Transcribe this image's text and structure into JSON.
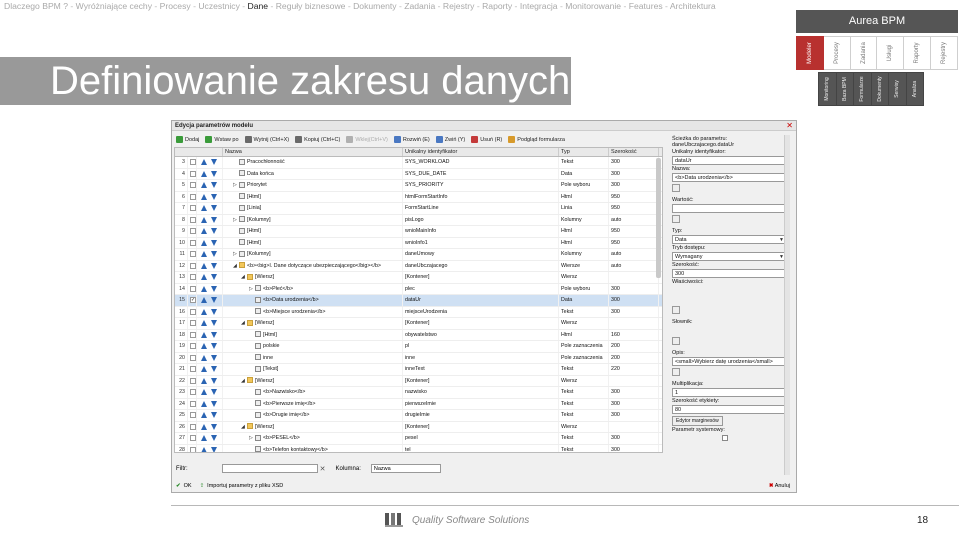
{
  "nav": {
    "items": [
      "Dlaczego BPM ?",
      "Wyróżniające cechy",
      "Procesy",
      "Uczestnicy",
      "Dane",
      "Reguły biznesowe",
      "Dokumenty",
      "Zadania",
      "Rejestry",
      "Raporty",
      "Integracja",
      "Monitorowanie",
      "Features",
      "Architektura"
    ],
    "active": "Dane"
  },
  "brand": "Aurea BPM",
  "vtabs": [
    "Modeler",
    "Procesy",
    "Zadania",
    "Usługi",
    "Raporty",
    "Rejestry"
  ],
  "subtabs": [
    "Monitoring",
    "Baza BPM",
    "Formularze",
    "Dokumenty",
    "Serwisy",
    "Analiza"
  ],
  "slide_title": "Definiowanie zakresu danych",
  "window": {
    "title": "Edycja parametrów modelu",
    "toolbar": [
      {
        "label": "Dodaj",
        "color": "#3a9b3a"
      },
      {
        "label": "Wstaw po",
        "color": "#3a9b3a"
      },
      {
        "label": "Wytnij (Ctrl+X)",
        "color": "#6a6a6a"
      },
      {
        "label": "Kopiuj (Ctrl+C)",
        "color": "#6a6a6a"
      },
      {
        "label": "Wklej(Ctrl+V)",
        "color": "#b0b0b0",
        "disabled": true
      },
      {
        "label": "Rozwiń (E)",
        "color": "#4a78c2"
      },
      {
        "label": "Zwiń (Y)",
        "color": "#4a78c2"
      },
      {
        "label": "Usuń (R)",
        "color": "#c43a3a"
      },
      {
        "label": "Podgląd formularza",
        "color": "#d79a2b"
      }
    ],
    "columns": [
      "Nazwa",
      "Unikalny identyfikator",
      "Typ",
      "Szerokość"
    ],
    "rows": [
      {
        "n": "3",
        "name": "Pracochłonność",
        "id": "SYS_WORKLOAD",
        "type": "Tekst",
        "w": "300",
        "indent": 1,
        "icon": "doc"
      },
      {
        "n": "4",
        "name": "Data końca",
        "id": "SYS_DUE_DATE",
        "type": "Data",
        "w": "300",
        "indent": 1,
        "icon": "doc"
      },
      {
        "n": "5",
        "name": "Priorytet",
        "id": "SYS_PRIORITY",
        "type": "Pole wyboru",
        "w": "300",
        "indent": 1,
        "icon": "doc",
        "exp": "▷"
      },
      {
        "n": "6",
        "name": "[Html]",
        "id": "htmlFormStartInfo",
        "type": "Html",
        "w": "950",
        "indent": 1,
        "icon": "doc"
      },
      {
        "n": "7",
        "name": "[Linia]",
        "id": "FormStartLine",
        "type": "Linia",
        "w": "950",
        "indent": 1,
        "icon": "doc"
      },
      {
        "n": "8",
        "name": "[Kolumny]",
        "id": "pisLogo",
        "type": "Kolumny",
        "w": "auto",
        "indent": 1,
        "icon": "doc",
        "exp": "▷"
      },
      {
        "n": "9",
        "name": "[Html]",
        "id": "wnioMainInfo",
        "type": "Html",
        "w": "950",
        "indent": 1,
        "icon": "doc"
      },
      {
        "n": "10",
        "name": "[Html]",
        "id": "wnioInfo1",
        "type": "Html",
        "w": "950",
        "indent": 1,
        "icon": "doc"
      },
      {
        "n": "11",
        "name": "[Kolumny]",
        "id": "daneUmowy",
        "type": "Kolumny",
        "w": "auto",
        "indent": 1,
        "icon": "doc",
        "exp": "▷"
      },
      {
        "n": "12",
        "name": "<b><big>I. Dane dotyczące ubezpieczającego</big></b>",
        "id": "daneUbczajacego",
        "type": "Wiersze",
        "w": "auto",
        "indent": 1,
        "icon": "folder",
        "exp": "◢"
      },
      {
        "n": "13",
        "name": "[Wiersz]",
        "id": "[Kontener]",
        "type": "Wiersz",
        "w": "",
        "indent": 2,
        "icon": "folder",
        "exp": "◢"
      },
      {
        "n": "14",
        "name": "<b>Płeć</b>",
        "id": "plec",
        "type": "Pole wyboru",
        "w": "300",
        "indent": 3,
        "icon": "doc",
        "exp": "▷"
      },
      {
        "n": "15",
        "name": "<b>Data urodzenia</b>",
        "id": "dataUr",
        "type": "Data",
        "w": "300",
        "indent": 3,
        "icon": "doc",
        "sel": true
      },
      {
        "n": "16",
        "name": "<b>Miejsce urodzenia</b>",
        "id": "miejsceUrodzenia",
        "type": "Tekst",
        "w": "300",
        "indent": 3,
        "icon": "doc"
      },
      {
        "n": "17",
        "name": "[Wiersz]",
        "id": "[Kontener]",
        "type": "Wiersz",
        "w": "",
        "indent": 2,
        "icon": "folder",
        "exp": "◢"
      },
      {
        "n": "18",
        "name": "[Html]",
        "id": "obywatelstwo",
        "type": "Html",
        "w": "160",
        "indent": 3,
        "icon": "doc"
      },
      {
        "n": "19",
        "name": "polskie",
        "id": "pl",
        "type": "Pole zaznaczenia",
        "w": "200",
        "indent": 3,
        "icon": "doc"
      },
      {
        "n": "20",
        "name": "inne",
        "id": "inne",
        "type": "Pole zaznaczenia",
        "w": "200",
        "indent": 3,
        "icon": "doc"
      },
      {
        "n": "21",
        "name": "[Tekst]",
        "id": "inneText",
        "type": "Tekst",
        "w": "220",
        "indent": 3,
        "icon": "doc"
      },
      {
        "n": "22",
        "name": "[Wiersz]",
        "id": "[Kontener]",
        "type": "Wiersz",
        "w": "",
        "indent": 2,
        "icon": "folder",
        "exp": "◢"
      },
      {
        "n": "23",
        "name": "<b>Nazwisko</b>",
        "id": "nazwisko",
        "type": "Tekst",
        "w": "300",
        "indent": 3,
        "icon": "doc"
      },
      {
        "n": "24",
        "name": "<b>Pierwsze imię</b>",
        "id": "pierwszeImie",
        "type": "Tekst",
        "w": "300",
        "indent": 3,
        "icon": "doc"
      },
      {
        "n": "25",
        "name": "<b>Drugie imię</b>",
        "id": "drugieImie",
        "type": "Tekst",
        "w": "300",
        "indent": 3,
        "icon": "doc"
      },
      {
        "n": "26",
        "name": "[Wiersz]",
        "id": "[Kontener]",
        "type": "Wiersz",
        "w": "",
        "indent": 2,
        "icon": "folder",
        "exp": "◢"
      },
      {
        "n": "27",
        "name": "<b>PESEL</b>",
        "id": "pesel",
        "type": "Tekst",
        "w": "300",
        "indent": 3,
        "icon": "doc",
        "exp": "▷"
      },
      {
        "n": "28",
        "name": "<b>Telefon kontaktowy</b>",
        "id": "tel",
        "type": "Tekst",
        "w": "300",
        "indent": 3,
        "icon": "doc"
      }
    ],
    "props": {
      "path_label": "Ścieżka do parametru:",
      "path_value": "daneUbczajacego.dataUr",
      "uid_label": "Unikalny identyfikator:",
      "uid_value": "dataUr",
      "name_label": "Nazwa:",
      "name_value": "<b>Data urodzenia</b>",
      "value_label": "Wartość:",
      "type_label": "Typ:",
      "type_value": "Data",
      "access_label": "Tryb dostępu:",
      "access_value": "Wymagany",
      "width_label": "Szerokość:",
      "width_value": "300",
      "props_label": "Właściwości:",
      "dict_label": "Słownik:",
      "desc_label": "Opis:",
      "desc_value": "<small>Wybierz datę urodzenia</small>",
      "mult_label": "Multiplikacja:",
      "mult_value": "1",
      "labelw_label": "Szerokość etykiety:",
      "labelw_value": "80",
      "margins_btn": "Edytor marginesów",
      "system_label": "Parametr systemowy:"
    },
    "filter": {
      "label": "Filtr:",
      "col_label": "Kolumna:",
      "col_value": "Nazwa"
    },
    "ok": "OK",
    "import": "Importuj parametry z pliku XSD",
    "cancel": "Anuluj"
  },
  "footer": "Quality Software Solutions",
  "page_number": "18"
}
